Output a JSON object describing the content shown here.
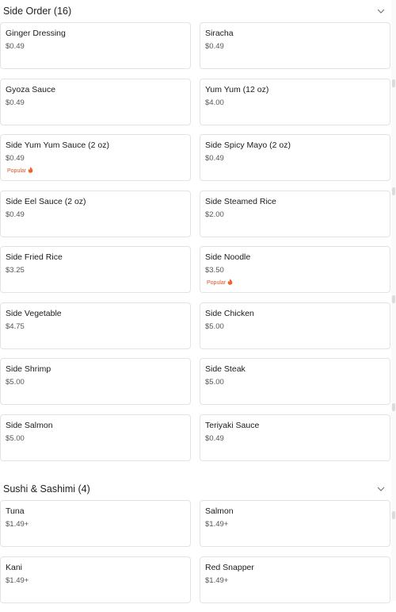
{
  "sections": [
    {
      "title": "Side Order (16)",
      "items": [
        {
          "name": "Ginger Dressing",
          "price": "$0.49"
        },
        {
          "name": "Siracha",
          "price": "$0.49"
        },
        {
          "name": "Gyoza Sauce",
          "price": "$0.49"
        },
        {
          "name": "Yum Yum (12 oz)",
          "price": "$4.00"
        },
        {
          "name": "Side Yum Yum Sauce (2 oz)",
          "price": "$0.49",
          "badge": "Popular"
        },
        {
          "name": "Side Spicy Mayo (2 oz)",
          "price": "$0.49"
        },
        {
          "name": "Side Eel Sauce (2 oz)",
          "price": "$0.49"
        },
        {
          "name": "Side Steamed Rice",
          "price": "$2.00"
        },
        {
          "name": "Side Fried Rice",
          "price": "$3.25"
        },
        {
          "name": "Side Noodle",
          "price": "$3.50",
          "badge": "Popular"
        },
        {
          "name": "Side Vegetable",
          "price": "$4.75"
        },
        {
          "name": "Side Chicken",
          "price": "$5.00"
        },
        {
          "name": "Side Shrimp",
          "price": "$5.00"
        },
        {
          "name": "Side Steak",
          "price": "$5.00"
        },
        {
          "name": "Side Salmon",
          "price": "$5.00"
        },
        {
          "name": "Teriyaki Sauce",
          "price": "$0.49"
        }
      ]
    },
    {
      "title": "Sushi & Sashimi (4)",
      "items": [
        {
          "name": "Tuna",
          "price": "$1.49+"
        },
        {
          "name": "Salmon",
          "price": "$1.49+"
        },
        {
          "name": "Kani",
          "price": "$1.49+"
        },
        {
          "name": "Red Snapper",
          "price": "$1.49+"
        }
      ]
    }
  ],
  "icons": {
    "collapse": "chevron-down-icon",
    "popular": "fire-icon"
  },
  "colors": {
    "badge": "#e0542b",
    "border": "#e3e3e3"
  }
}
